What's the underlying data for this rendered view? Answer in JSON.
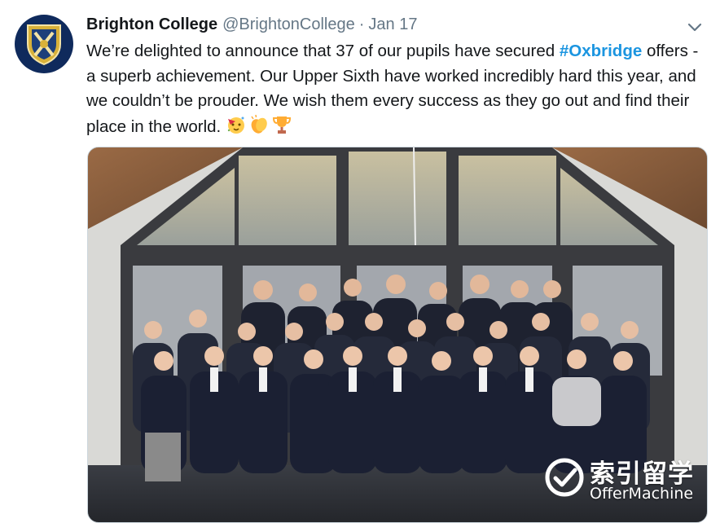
{
  "tweet": {
    "author_name": "Brighton College",
    "handle": "@BrightonCollege",
    "separator": "·",
    "date": "Jan 17",
    "text_before_hashtag": "We’re delighted to announce that 37 of our pupils have secured ",
    "hashtag": "#Oxbridge",
    "text_after_hashtag": " offers - a superb achievement. Our Upper Sixth have worked incredibly hard this year, and we couldn’t be prouder. We wish them every success as they go out and find their place in the world. ",
    "emojis": [
      "party-face-emoji",
      "clapping-hands-emoji",
      "trophy-emoji"
    ]
  },
  "colors": {
    "hashtag": "#1b95e0",
    "muted": "#657786",
    "avatar_bg": "#0f2a5c"
  },
  "watermark": {
    "chinese": "索引留学",
    "english": "OfferMachine"
  }
}
